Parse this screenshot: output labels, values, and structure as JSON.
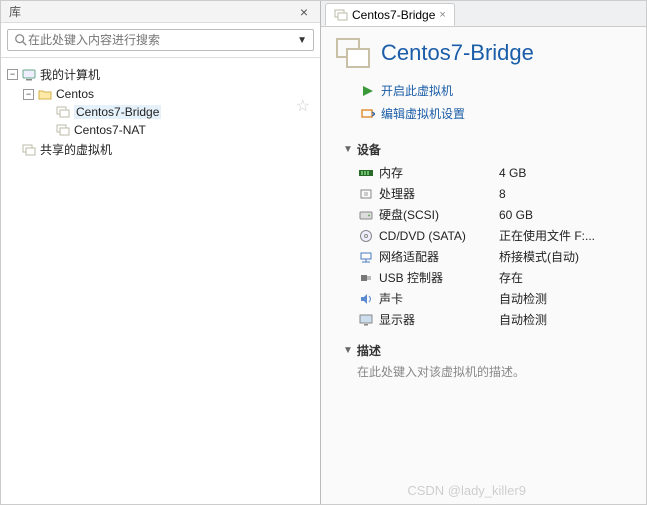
{
  "left": {
    "title": "库",
    "search_placeholder": "在此处键入内容进行搜索",
    "tree": {
      "root_label": "我的计算机",
      "folder_label": "Centos",
      "vm1_label": "Centos7-Bridge",
      "vm2_label": "Centos7-NAT",
      "shared_label": "共享的虚拟机"
    }
  },
  "right": {
    "tab_label": "Centos7-Bridge",
    "vm_title": "Centos7-Bridge",
    "action_power": "开启此虚拟机",
    "action_edit": "编辑虚拟机设置",
    "section_devices": "设备",
    "devices": [
      {
        "name": "内存",
        "value": "4 GB"
      },
      {
        "name": "处理器",
        "value": "8"
      },
      {
        "name": "硬盘(SCSI)",
        "value": "60 GB"
      },
      {
        "name": "CD/DVD (SATA)",
        "value": "正在使用文件 F:..."
      },
      {
        "name": "网络适配器",
        "value": "桥接模式(自动)"
      },
      {
        "name": "USB 控制器",
        "value": "存在"
      },
      {
        "name": "声卡",
        "value": "自动检测"
      },
      {
        "name": "显示器",
        "value": "自动检测"
      }
    ],
    "section_desc": "描述",
    "desc_placeholder": "在此处键入对该虚拟机的描述。"
  },
  "watermark": "CSDN @lady_killer9"
}
